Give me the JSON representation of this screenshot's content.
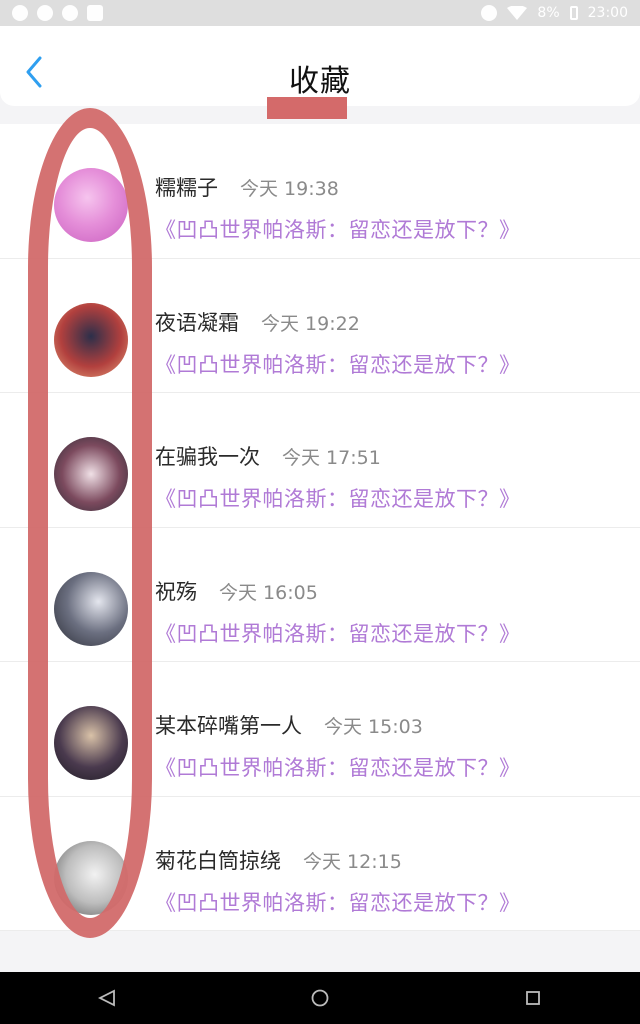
{
  "status_bar": {
    "battery": "8%",
    "time": "23:00",
    "icons": [
      "notification-icon",
      "sync-icon",
      "sync-icon",
      "image-icon",
      "dnd-icon",
      "wifi-icon",
      "battery-icon"
    ]
  },
  "header": {
    "title": "收藏",
    "back_icon": "chevron-left-icon"
  },
  "items": [
    {
      "name": "糯糯子",
      "time": "今天 19:38",
      "title": "《凹凸世界帕洛斯：留恋还是放下？》",
      "avatar_color": "#e58fd9"
    },
    {
      "name": "夜语凝霜",
      "time": "今天 19:22",
      "title": "《凹凸世界帕洛斯：留恋还是放下？》",
      "avatar_color": "#b2403e"
    },
    {
      "name": "在骗我一次",
      "time": "今天 17:51",
      "title": "《凹凸世界帕洛斯：留恋还是放下？》",
      "avatar_color": "#7c4a5e"
    },
    {
      "name": "祝殇",
      "time": "今天 16:05",
      "title": "《凹凸世界帕洛斯：留恋还是放下？》",
      "avatar_color": "#6b6f80"
    },
    {
      "name": "某本碎嘴第一人",
      "time": "今天 15:03",
      "title": "《凹凸世界帕洛斯：留恋还是放下？》",
      "avatar_color": "#4a3a4e"
    },
    {
      "name": "菊花白筒掠绕",
      "time": "今天 12:15",
      "title": "《凹凸世界帕洛斯：留恋还是放下？》",
      "avatar_color": "#bdbdbd"
    }
  ],
  "nav_bar": {
    "icons": [
      "back-triangle-icon",
      "home-circle-icon",
      "recents-square-icon"
    ]
  },
  "colors": {
    "accent": "#b07ad6",
    "back_arrow": "#2f9ff0",
    "annotation": "#d26a6a"
  }
}
